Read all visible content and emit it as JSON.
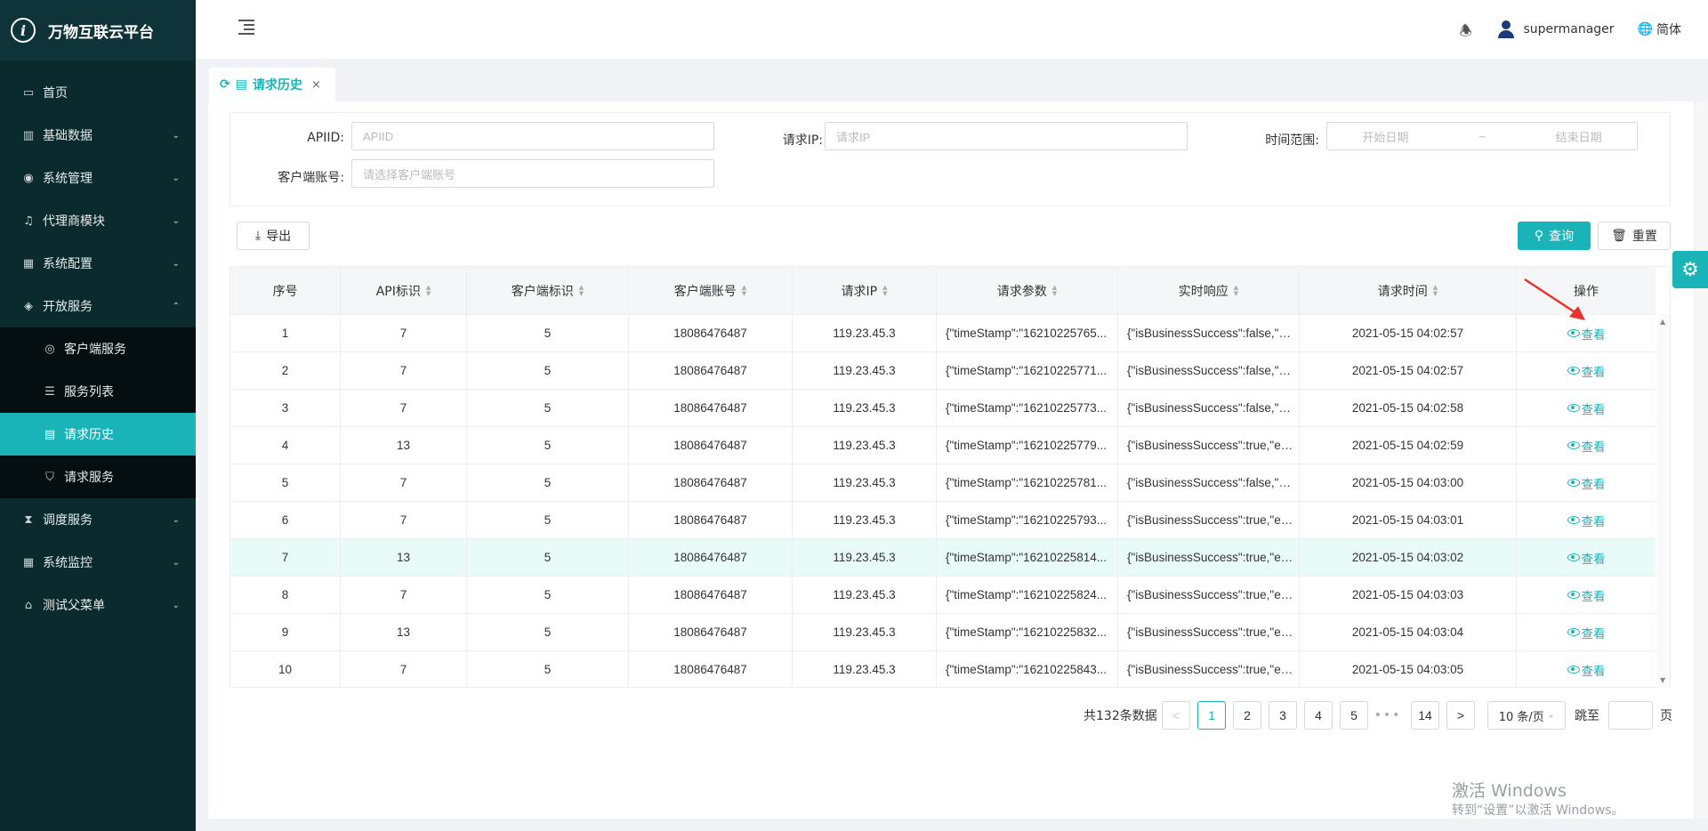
{
  "brand": {
    "logo": "i",
    "title": "万物互联云平台"
  },
  "sidebar": {
    "items": [
      {
        "label": "首页",
        "icon": "calendar-icon",
        "glyph": "▭",
        "chevron": ""
      },
      {
        "label": "基础数据",
        "icon": "barcode-icon",
        "glyph": "▥",
        "chevron": "⌄"
      },
      {
        "label": "系统管理",
        "icon": "camera-icon",
        "glyph": "◉",
        "chevron": "⌄"
      },
      {
        "label": "代理商模块",
        "icon": "bell-icon",
        "glyph": "♫",
        "chevron": "⌄"
      },
      {
        "label": "系统配置",
        "icon": "grid-icon",
        "glyph": "▦",
        "chevron": "⌄"
      },
      {
        "label": "开放服务",
        "icon": "tag-icon",
        "glyph": "◈",
        "chevron": "⌃"
      }
    ],
    "subitems": [
      {
        "label": "客户端服务",
        "icon": "target-icon",
        "glyph": "◎"
      },
      {
        "label": "服务列表",
        "icon": "list-icon",
        "glyph": "☰"
      },
      {
        "label": "请求历史",
        "icon": "calc-icon",
        "glyph": "▤"
      },
      {
        "label": "请求服务",
        "icon": "shield-icon",
        "glyph": "⛉"
      }
    ],
    "items2": [
      {
        "label": "调度服务",
        "icon": "hourglass-icon",
        "glyph": "⧗",
        "chevron": "⌄"
      },
      {
        "label": "系统监控",
        "icon": "monitor-icon",
        "glyph": "▦",
        "chevron": "⌄"
      },
      {
        "label": "测试父菜单",
        "icon": "bank-icon",
        "glyph": "⌂",
        "chevron": "⌄"
      }
    ]
  },
  "header": {
    "user": "supermanager",
    "lang": "简体"
  },
  "tab": {
    "label": "请求历史",
    "close": "×"
  },
  "filter": {
    "apiid_label": "APIID:",
    "apiid_placeholder": "APIID",
    "ip_label": "请求IP:",
    "ip_placeholder": "请求IP",
    "time_label": "时间范围:",
    "start_placeholder": "开始日期",
    "sep": "~",
    "end_placeholder": "结束日期",
    "account_label": "客户端账号:",
    "account_placeholder": "请选择客户端账号"
  },
  "buttons": {
    "export": "导出",
    "query": "查询",
    "reset": "重置"
  },
  "table": {
    "columns": [
      "序号",
      "API标识",
      "客户端标识",
      "客户端账号",
      "请求IP",
      "请求参数",
      "实时响应",
      "请求时间",
      "操作"
    ],
    "rows": [
      [
        "1",
        "7",
        "5",
        "18086476487",
        "119.23.45.3",
        "{\"timeStamp\":\"16210225765...",
        "{\"isBusinessSuccess\":false,\"b...",
        "2021-05-15 04:02:57"
      ],
      [
        "2",
        "7",
        "5",
        "18086476487",
        "119.23.45.3",
        "{\"timeStamp\":\"16210225771...",
        "{\"isBusinessSuccess\":false,\"b...",
        "2021-05-15 04:02:57"
      ],
      [
        "3",
        "7",
        "5",
        "18086476487",
        "119.23.45.3",
        "{\"timeStamp\":\"16210225773...",
        "{\"isBusinessSuccess\":false,\"b...",
        "2021-05-15 04:02:58"
      ],
      [
        "4",
        "13",
        "5",
        "18086476487",
        "119.23.45.3",
        "{\"timeStamp\":\"16210225779...",
        "{\"isBusinessSuccess\":true,\"ex...",
        "2021-05-15 04:02:59"
      ],
      [
        "5",
        "7",
        "5",
        "18086476487",
        "119.23.45.3",
        "{\"timeStamp\":\"16210225781...",
        "{\"isBusinessSuccess\":false,\"b...",
        "2021-05-15 04:03:00"
      ],
      [
        "6",
        "7",
        "5",
        "18086476487",
        "119.23.45.3",
        "{\"timeStamp\":\"16210225793...",
        "{\"isBusinessSuccess\":true,\"ex...",
        "2021-05-15 04:03:01"
      ],
      [
        "7",
        "13",
        "5",
        "18086476487",
        "119.23.45.3",
        "{\"timeStamp\":\"16210225814...",
        "{\"isBusinessSuccess\":true,\"ex...",
        "2021-05-15 04:03:02"
      ],
      [
        "8",
        "7",
        "5",
        "18086476487",
        "119.23.45.3",
        "{\"timeStamp\":\"16210225824...",
        "{\"isBusinessSuccess\":true,\"ex...",
        "2021-05-15 04:03:03"
      ],
      [
        "9",
        "13",
        "5",
        "18086476487",
        "119.23.45.3",
        "{\"timeStamp\":\"16210225832...",
        "{\"isBusinessSuccess\":true,\"ex...",
        "2021-05-15 04:03:04"
      ],
      [
        "10",
        "7",
        "5",
        "18086476487",
        "119.23.45.3",
        "{\"timeStamp\":\"16210225843...",
        "{\"isBusinessSuccess\":true,\"ex...",
        "2021-05-15 04:03:05"
      ]
    ],
    "action_label": "查看"
  },
  "pagination": {
    "total": "共132条数据",
    "pages": [
      "1",
      "2",
      "3",
      "4",
      "5"
    ],
    "ellipsis": "•••",
    "last": "14",
    "page_size": "10 条/页",
    "jump_label": "跳至",
    "page_suffix": "页"
  },
  "watermark": {
    "line1": "激活 Windows",
    "line2": "转到“设置”以激活 Windows。"
  },
  "colors": {
    "accent": "#1ab3b8",
    "sidebar_bg": "#0b2a2e",
    "arrow": "#e8322b"
  }
}
